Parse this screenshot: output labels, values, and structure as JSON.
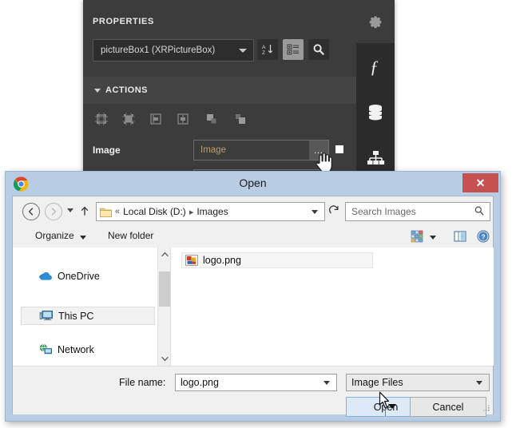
{
  "designer": {
    "panel_title": "PROPERTIES",
    "gear_icon": "gear-icon",
    "object_combo": {
      "value": "pictureBox1 (XRPictureBox)",
      "dropdown_icon": "chevron-down-icon"
    },
    "toolbuttons": [
      {
        "name": "sort-alphabetical-button",
        "icon": "sort-az-icon",
        "label": "A↓Z",
        "active": false
      },
      {
        "name": "categorized-view-button",
        "icon": "categorize-icon",
        "active": true
      },
      {
        "name": "search-properties-button",
        "icon": "search-icon",
        "active": false
      }
    ],
    "actions_section": {
      "label": "ACTIONS",
      "expander_icon": "triangle-down-icon",
      "tools": [
        "align-to-grid-icon",
        "size-to-grid-icon",
        "align-left-icon",
        "align-right-icon",
        "bring-to-front-icon",
        "send-to-back-icon"
      ]
    },
    "image_property": {
      "label": "Image",
      "value": "Image",
      "ellipsis_label": "…",
      "ellipsis_icon": "ellipsis-icon",
      "swatch_icon": "white-square-icon"
    },
    "right_rail": [
      {
        "name": "expression-editor-icon",
        "glyph": "ƒ"
      },
      {
        "name": "data-source-icon",
        "glyph": "database"
      },
      {
        "name": "report-explorer-icon",
        "glyph": "hierarchy"
      }
    ],
    "cursor": "hand-cursor"
  },
  "dialog": {
    "title": "Open",
    "app_icon": "chrome-logo-icon",
    "close_label": "✕",
    "navigation": {
      "back_icon": "arrow-left-icon",
      "forward_icon": "arrow-right-icon",
      "history_icon": "chevron-down-icon",
      "up_icon": "arrow-up-icon",
      "folder_icon": "folder-icon",
      "breadcrumb_prefix": "«",
      "breadcrumb": [
        "Local Disk (D:)",
        "Images"
      ],
      "breadcrumb_separator": "▸",
      "address_caret_icon": "chevron-down-icon",
      "refresh_icon": "refresh-icon"
    },
    "search": {
      "placeholder": "Search Images",
      "icon": "search-icon"
    },
    "commandbar": {
      "organize_label": "Organize",
      "organize_caret_icon": "caret-down-icon",
      "new_folder_label": "New folder",
      "view_icon": "grid-view-icon",
      "view_caret_icon": "caret-down-icon",
      "preview_pane_icon": "preview-pane-icon",
      "help_icon": "help-icon"
    },
    "sidebar": {
      "items": [
        {
          "label": "OneDrive",
          "icon": "onedrive-cloud-icon",
          "selected": false
        },
        {
          "label": "This PC",
          "icon": "this-pc-icon",
          "selected": true
        },
        {
          "label": "Network",
          "icon": "network-icon",
          "selected": false
        }
      ],
      "scroll_up_icon": "chevron-up-icon",
      "scroll_down_icon": "chevron-down-icon"
    },
    "filelist": {
      "items": [
        {
          "name": "logo.png",
          "icon": "image-file-icon"
        }
      ]
    },
    "footer": {
      "filename_label": "File name:",
      "filename_value": "logo.png",
      "filename_caret_icon": "chevron-down-icon",
      "filter_value": "Image Files",
      "filter_caret_icon": "chevron-down-icon",
      "open_label": "Open",
      "open_split_caret_icon": "caret-down-icon",
      "cancel_label": "Cancel",
      "resize_grip_icon": "resize-grip-icon"
    },
    "cursor": "arrow-cursor"
  },
  "colors": {
    "panel_bg": "#3c3c3c",
    "panel_header_bg": "#444444",
    "rail_bg": "#2b2b2b",
    "dialog_frame": "#b8cce4",
    "dialog_bg": "#f0f0f0",
    "close_red": "#c75050",
    "accent_blue": "#7eb4e2",
    "value_text": "#b9a06b"
  }
}
